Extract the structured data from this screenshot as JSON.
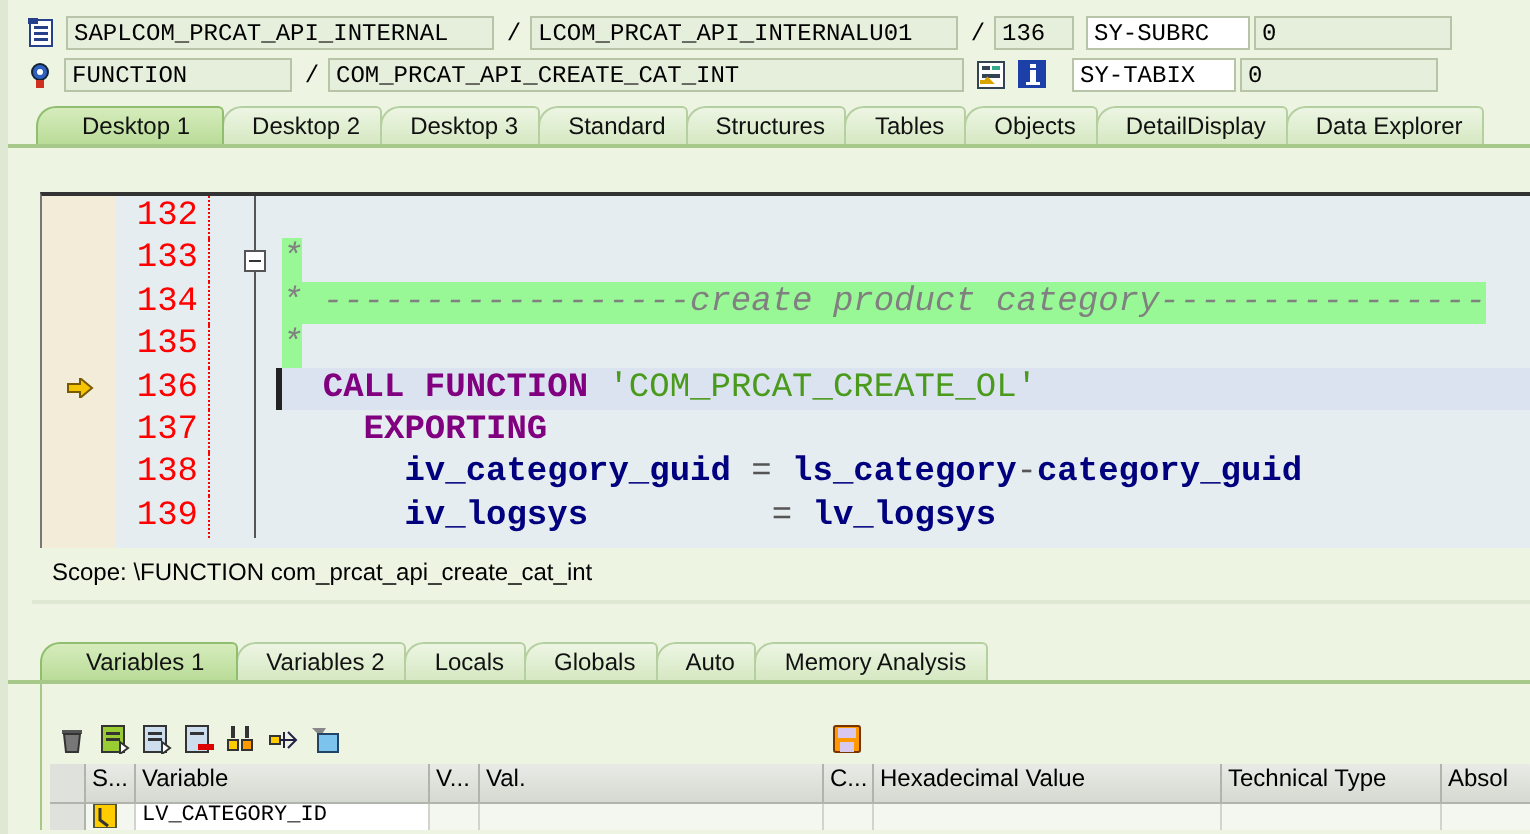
{
  "header": {
    "program": "SAPLCOM_PRCAT_API_INTERNAL",
    "separator_1": "/",
    "include": "LCOM_PRCAT_API_INTERNALU01",
    "separator_2": "/",
    "line": "136",
    "sy_subrc_label": "SY-SUBRC",
    "sy_subrc_value": "0",
    "event_type": "FUNCTION",
    "separator_3": "/",
    "event_name": "COM_PRCAT_API_CREATE_CAT_INT",
    "sy_tabix_label": "SY-TABIX",
    "sy_tabix_value": "0"
  },
  "desktop_tabs": [
    {
      "label": "Desktop 1",
      "selected": true
    },
    {
      "label": "Desktop 2",
      "selected": false
    },
    {
      "label": "Desktop 3",
      "selected": false
    },
    {
      "label": "Standard",
      "selected": false
    },
    {
      "label": "Structures",
      "selected": false
    },
    {
      "label": "Tables",
      "selected": false
    },
    {
      "label": "Objects",
      "selected": false
    },
    {
      "label": "DetailDisplay",
      "selected": false
    },
    {
      "label": "Data Explorer",
      "selected": false
    }
  ],
  "editor": {
    "lines": [
      {
        "number": "132",
        "current": false
      },
      {
        "number": "133",
        "current": false,
        "expanded": true,
        "tokens": [
          {
            "kind": "comment",
            "text": "*"
          }
        ]
      },
      {
        "number": "134",
        "current": false,
        "tokens": [
          {
            "kind": "comment",
            "text": "* ------------------create product category----------------"
          }
        ]
      },
      {
        "number": "135",
        "current": false,
        "tokens": [
          {
            "kind": "comment",
            "text": "*"
          }
        ]
      },
      {
        "number": "136",
        "current": true,
        "tokens": [
          {
            "kind": "keyword",
            "text": "  CALL FUNCTION "
          },
          {
            "kind": "string",
            "text": "'COM_PRCAT_CREATE_OL'"
          }
        ]
      },
      {
        "number": "137",
        "current": false,
        "tokens": [
          {
            "kind": "keyword",
            "text": "    EXPORTING"
          }
        ]
      },
      {
        "number": "138",
        "current": false,
        "tokens": [
          {
            "kind": "name",
            "text": "      iv_category_guid"
          },
          {
            "kind": "op",
            "text": " = "
          },
          {
            "kind": "name",
            "text": "ls_category"
          },
          {
            "kind": "op",
            "text": "-"
          },
          {
            "kind": "name",
            "text": "category_guid"
          }
        ]
      },
      {
        "number": "139",
        "current": false,
        "tokens": [
          {
            "kind": "name",
            "text": "      iv_logsys"
          },
          {
            "kind": "op",
            "text": "         = "
          },
          {
            "kind": "name",
            "text": "lv_logsys"
          }
        ]
      }
    ]
  },
  "scope": "Scope: \\FUNCTION com_prcat_api_create_cat_int",
  "variable_tabs": [
    {
      "label": "Variables 1",
      "selected": true
    },
    {
      "label": "Variables 2",
      "selected": false
    },
    {
      "label": "Locals",
      "selected": false
    },
    {
      "label": "Globals",
      "selected": false
    },
    {
      "label": "Auto",
      "selected": false
    },
    {
      "label": "Memory Analysis",
      "selected": false
    }
  ],
  "variables_table": {
    "columns": [
      "S...",
      "Variable",
      "V...",
      "Val.",
      "C...",
      "Hexadecimal Value",
      "Technical Type",
      "Absol"
    ],
    "rows": [
      {
        "cells": [
          "",
          "LV_CATEGORY_ID",
          "",
          "",
          "",
          "",
          "",
          ""
        ]
      }
    ]
  }
}
